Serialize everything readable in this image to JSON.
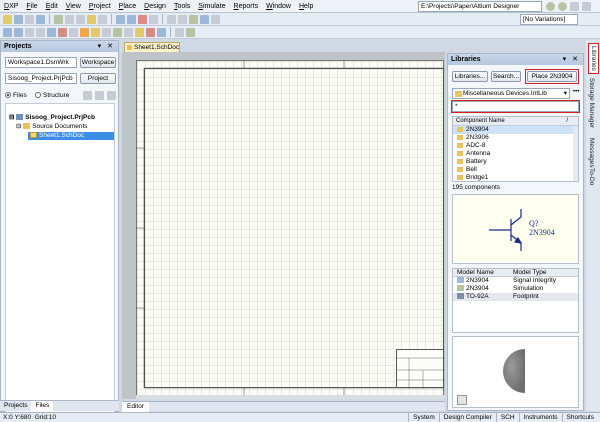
{
  "menu": {
    "items": [
      "DXP",
      "File",
      "Edit",
      "View",
      "Project",
      "Place",
      "Design",
      "Tools",
      "Simulate",
      "Reports",
      "Window",
      "Help"
    ],
    "path": "E:\\Projects\\Paper\\Altium Designer"
  },
  "toolbar": {
    "variations": "[No Variations]"
  },
  "projects": {
    "title": "Projects",
    "workspace_value": "Workspace1.DsnWrk",
    "workspace_button": "Workspace",
    "project_value": "Sisoog_Project.PrjPcb",
    "project_button": "Project",
    "radio_files": "Files",
    "radio_structure": "Structure",
    "tree": {
      "project": "Sisoog_Project.PrjPcb",
      "folder": "Source Documents",
      "file": "Sheet1.SchDoc"
    },
    "tabs": [
      "Projects",
      "Files"
    ]
  },
  "document": {
    "tab": "Sheet1.SchDoc",
    "editor_tab": "Editor"
  },
  "libraries": {
    "title": "Libraries",
    "btn_libraries": "Libraries...",
    "btn_search": "Search...",
    "btn_place": "Place 2N3904",
    "library_value": "Miscellaneous Devices.IntLib",
    "filter_value": "*",
    "column_header": "Component Name",
    "components": [
      "2N3904",
      "2N3906",
      "ADC-8",
      "Antenna",
      "Battery",
      "Bell",
      "Bridge1"
    ],
    "count": "195 components",
    "symbol_designator": "Q?",
    "symbol_comment": "2N3904",
    "model_headers": [
      "Model Name",
      "Model Type"
    ],
    "models": [
      {
        "name": "2N3904",
        "type": "Signal Integrity"
      },
      {
        "name": "2N3904",
        "type": "Simulation"
      },
      {
        "name": "TO-92A",
        "type": "Footprint"
      }
    ]
  },
  "side_tabs": [
    "Libraries",
    "Storage Manager",
    "Messages",
    "To-Do"
  ],
  "status": {
    "coords": "X:0 Y:680",
    "grid": "Grid:10",
    "right": [
      "System",
      "Design Compiler",
      "SCH",
      "Instruments",
      "Shortcuts"
    ]
  }
}
